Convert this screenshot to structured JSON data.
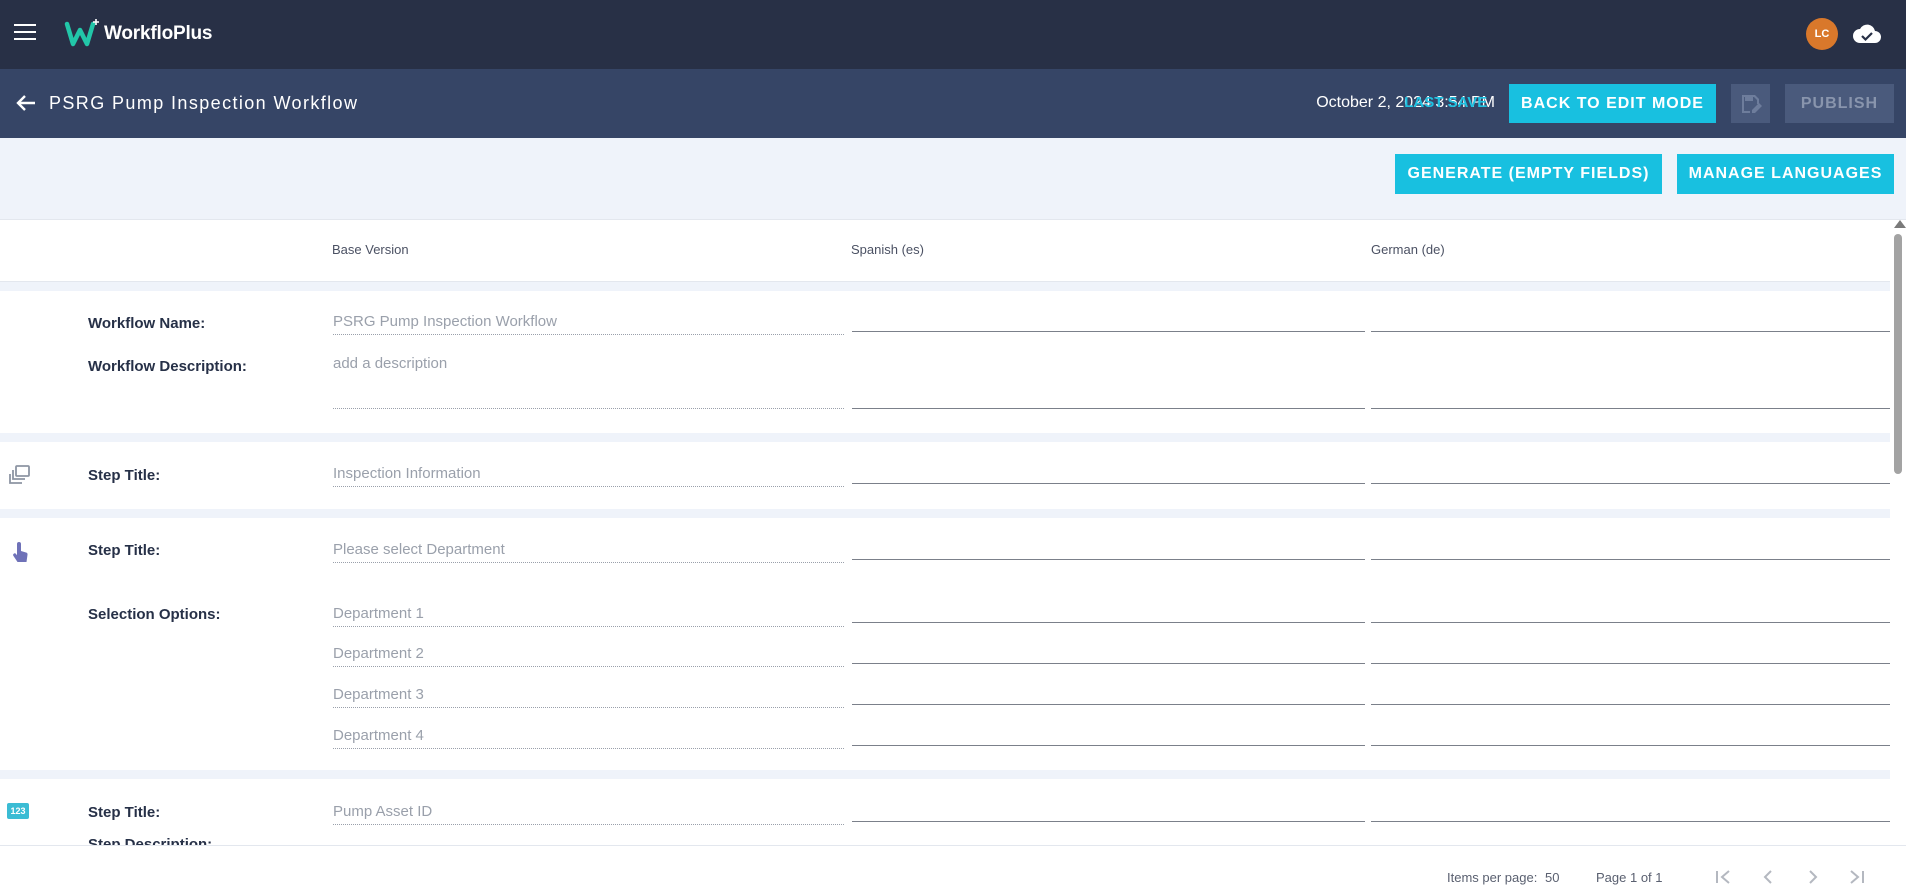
{
  "app": {
    "brand": "WorkfloPlus",
    "user_initials": "LC"
  },
  "colors": {
    "topbar": "#283046",
    "subbar": "#364566",
    "accent": "#18c0e0",
    "avatar": "#d9782b"
  },
  "icons": [
    "menu-icon",
    "logo-icon",
    "cloud-done-icon",
    "arrow-back-icon",
    "save-edit-icon",
    "step-group-icon",
    "touch-select-icon",
    "number-input-icon",
    "first-page-icon",
    "prev-page-icon",
    "next-page-icon",
    "last-page-icon"
  ],
  "header": {
    "title": "PSRG Pump Inspection Workflow",
    "last_save_label": "LAST SAVE",
    "last_save_value": "October 2, 2024 3:54 PM",
    "back_to_edit": "BACK TO EDIT MODE",
    "publish": "PUBLISH"
  },
  "toolbar": {
    "generate": "GENERATE (EMPTY FIELDS)",
    "manage_languages": "MANAGE LANGUAGES"
  },
  "columns": {
    "base": "Base Version",
    "es": "Spanish (es)",
    "de": "German (de)"
  },
  "rows": {
    "workflow_name_label": "Workflow Name:",
    "workflow_name_value": "PSRG Pump Inspection Workflow",
    "workflow_desc_label": "Workflow Description:",
    "workflow_desc_value": "add a description",
    "step1_label": "Step Title:",
    "step1_value": "Inspection Information",
    "step2_label": "Step Title:",
    "step2_value": "Please select Department",
    "options_label": "Selection Options:",
    "options": [
      "Department 1",
      "Department 2",
      "Department 3",
      "Department 4"
    ],
    "step3_label": "Step Title:",
    "step3_value": "Pump Asset ID",
    "step3_desc_label": "Step Description:"
  },
  "footer": {
    "items_per_page_label": "Items per page:",
    "items_per_page_value": "50",
    "page_info": "Page 1 of 1"
  }
}
